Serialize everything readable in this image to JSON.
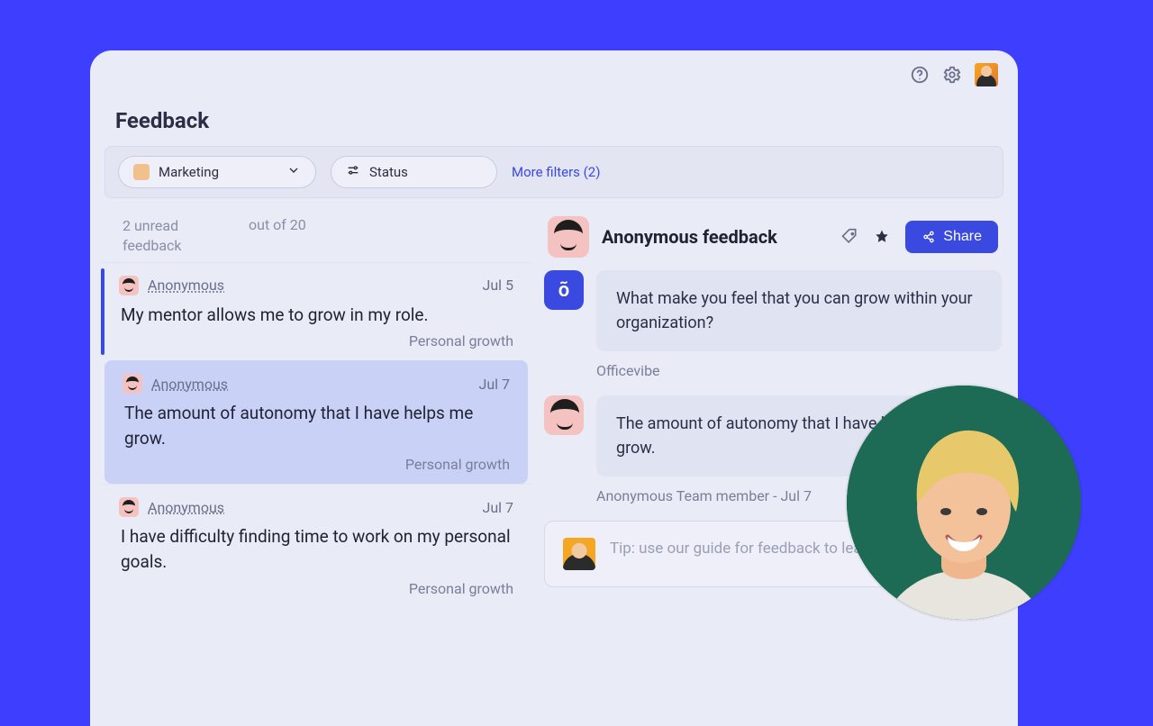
{
  "page": {
    "title": "Feedback"
  },
  "filters": {
    "team_label": "Marketing",
    "status_label": "Status",
    "more_label": "More filters (2)"
  },
  "summary": {
    "unread_line1": "2 unread",
    "unread_line2": "feedback",
    "total": "out of 20"
  },
  "list": [
    {
      "author": "Anonymous",
      "date": "Jul 5",
      "body": "My mentor allows me to grow in my role.",
      "tag": "Personal growth",
      "state": "active"
    },
    {
      "author": "Anonymous",
      "date": "Jul 7",
      "body": "The amount of autonomy that I have helps me grow.",
      "tag": "Personal growth",
      "state": "selected"
    },
    {
      "author": "Anonymous",
      "date": "Jul 7",
      "body": "I have difficulty finding time to work on my personal goals.",
      "tag": "Personal growth",
      "state": ""
    }
  ],
  "detail": {
    "title": "Anonymous feedback",
    "share_label": "Share",
    "prompt": {
      "text": "What make you feel that you can grow within your organization?",
      "source": "Officevibe"
    },
    "answer": {
      "text": "The amount of autonomy that I have helps me grow.",
      "source": "Anonymous Team member  -  Jul 7"
    },
    "reply_placeholder": "Tip: use our guide for feedback to learn how to reply."
  }
}
